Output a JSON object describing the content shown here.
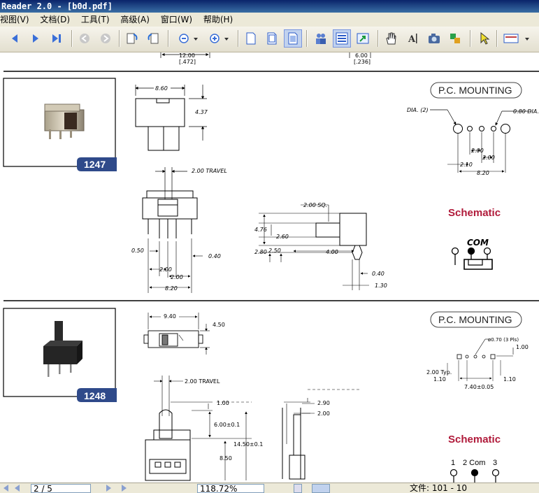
{
  "window": {
    "title": "Reader 2.0 - [b0d.pdf]"
  },
  "menu": [
    "视图(V)",
    "文档(D)",
    "工具(T)",
    "高级(A)",
    "窗口(W)",
    "帮助(H)"
  ],
  "toolbar": {
    "icons": [
      "prev-page-icon",
      "next-page-icon",
      "last-page-icon",
      "back-icon",
      "forward-icon",
      "rotate-cw-icon",
      "rotate-ccw-icon",
      "zoom-out-icon",
      "zoom-in-icon",
      "single-page-icon",
      "continuous-page-icon",
      "fit-page-icon",
      "find-people-icon",
      "contents-icon",
      "export-icon",
      "hand-tool-icon",
      "text-select-icon",
      "snapshot-icon",
      "plugin-icon",
      "select-arrow-icon",
      "view-options-icon"
    ]
  },
  "doc": {
    "top_dims": {
      "left": "12.00",
      "left_in": "[.472]",
      "right": "6.00",
      "right_in": "[.236]"
    },
    "part1": {
      "number": "1247",
      "pc_mounting": "P.C. MOUNTING",
      "schematic": "Schematic",
      "com": "COM",
      "dims": {
        "w": "8.60",
        "h": "4.37",
        "travel": "2.00 TRAVEL",
        "dia2": "DIA. (2)",
        "dia080": "0.80 DIA.",
        "pitch200a": "2.00",
        "pitch200b": "2.00",
        "pitch210": "2.10",
        "span820": "8.20",
        "sq": "2.00 SQ.",
        "h476": "4.76",
        "h260": "2.60",
        "h280": "2.80",
        "h250": "2.50",
        "l400": "4.00",
        "p040": "0.40",
        "p130": "1.30",
        "f050": "0.50",
        "f040": "0.40",
        "f200a": "2.00",
        "f200b": "2.00",
        "f820": "8.20"
      }
    },
    "part2": {
      "number": "1248",
      "pc_mounting": "P.C. MOUNTING",
      "schematic": "Schematic",
      "dims": {
        "w940": "9.40",
        "h450": "4.50",
        "travel": "2.00  TRAVEL",
        "hole": "ø0.70 (3 Pls)",
        "r100": "1.00",
        "typ": "2.00   Typ.",
        "l110": "1.10",
        "r110": "1.10",
        "span": "7.40±0.05",
        "d100": "1.00",
        "d600": "6.00±0.1",
        "d1450": "14.50±0.1",
        "d850": "8.50",
        "s290": "2.90",
        "s200": "2.00"
      },
      "pins": {
        "p1": "1",
        "p2": "2 Com",
        "p3": "3"
      }
    }
  },
  "status": {
    "page": "2 / 5",
    "zoom": "118.72%",
    "file_label": "文件: 101 - 10"
  }
}
